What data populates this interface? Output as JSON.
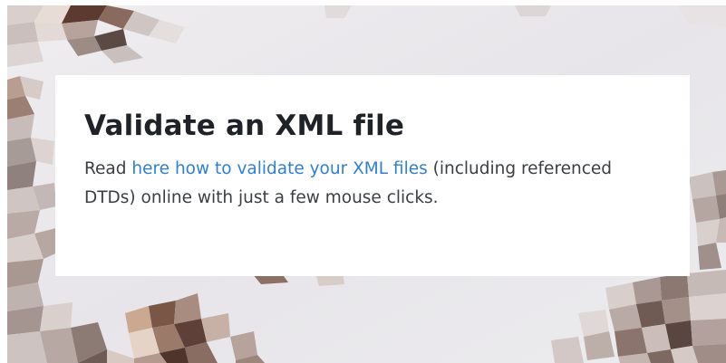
{
  "card": {
    "title": "Validate an XML file",
    "text_before_link": "Read ",
    "link_text": "here how to validate your XML files",
    "text_after_link": " (including referenced DTDs) online with just a few mouse clicks."
  },
  "colors": {
    "background": "#ebe8ea",
    "card_background": "#ffffff",
    "title": "#1f2328",
    "body_text": "#3b3f44",
    "link": "#2f7fd6"
  }
}
